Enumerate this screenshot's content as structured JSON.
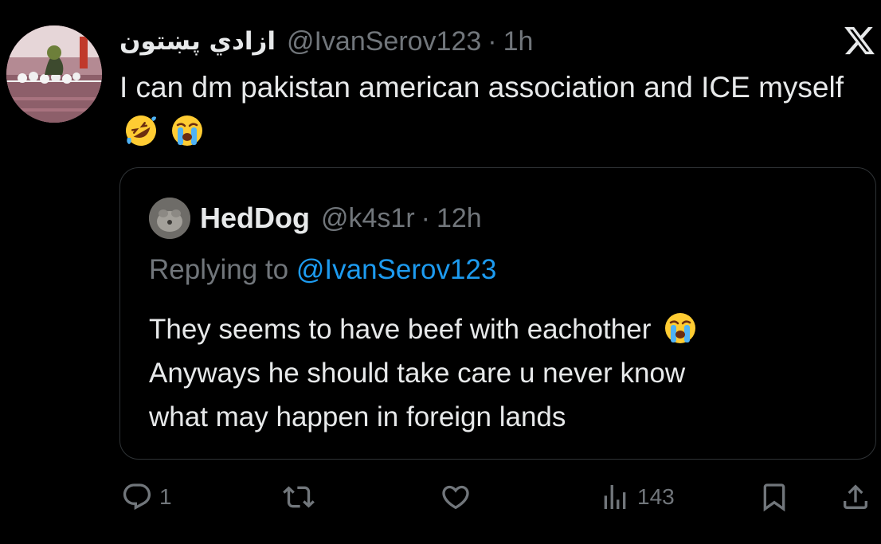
{
  "author": {
    "display_name": "ازادي پښتون",
    "handle": "@IvanSerov123",
    "separator": "·",
    "time": "1h"
  },
  "tweet": {
    "text": "I can dm pakistan american association and ICE myself",
    "emojis": [
      "rolling-on-floor-laughing-emoji",
      "loudly-crying-emoji"
    ]
  },
  "quoted": {
    "name": "HedDog",
    "handle": "@k4s1r",
    "separator": "·",
    "time": "12h",
    "replying_prefix": "Replying to",
    "replying_to": "@IvanSerov123",
    "text_line1": "They seems to have beef with eachother",
    "text_line2": "Anyways he should take care u never know",
    "text_line3": "what may happen in foreign lands"
  },
  "actions": {
    "replies": "1",
    "views": "143"
  },
  "icons": [
    "reply-icon",
    "retweet-icon",
    "like-icon",
    "views-icon",
    "bookmark-icon",
    "share-icon",
    "x-logo-icon"
  ],
  "colors": {
    "background": "#000000",
    "text": "#e7e9ea",
    "muted": "#71767b",
    "link": "#1d9bf0",
    "border": "#2f3336"
  }
}
